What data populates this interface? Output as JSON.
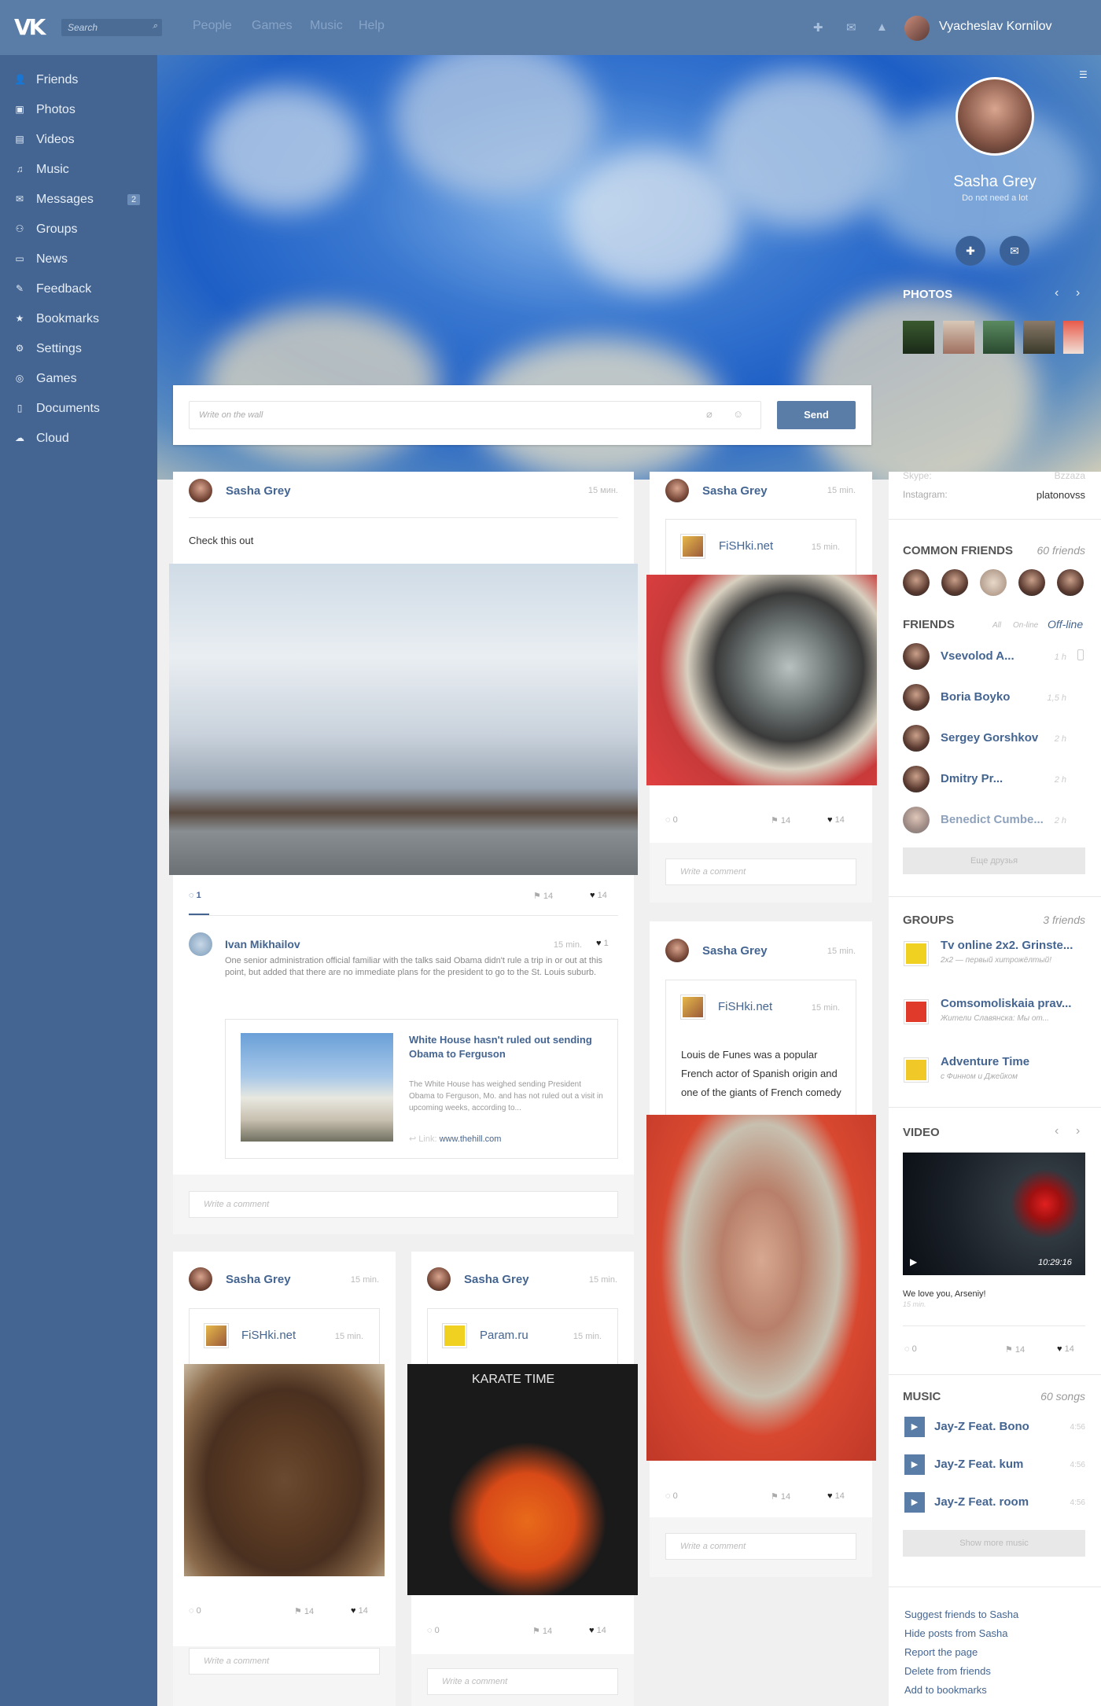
{
  "topbar": {
    "logo": "VK",
    "search_placeholder": "Search",
    "nav": [
      "People",
      "Games",
      "Music",
      "Help"
    ],
    "user_name": "Vyacheslav Kornilov"
  },
  "sidebar": {
    "items": [
      {
        "label": "Friends",
        "icon": "person-icon"
      },
      {
        "label": "Photos",
        "icon": "photo-icon"
      },
      {
        "label": "Videos",
        "icon": "film-icon"
      },
      {
        "label": "Music",
        "icon": "music-icon"
      },
      {
        "label": "Messages",
        "icon": "envelope-icon",
        "count": "2"
      },
      {
        "label": "Groups",
        "icon": "group-icon"
      },
      {
        "label": "News",
        "icon": "speech-icon"
      },
      {
        "label": "Feedback",
        "icon": "feedback-icon"
      },
      {
        "label": "Bookmarks",
        "icon": "star-icon"
      },
      {
        "label": "Settings",
        "icon": "gear-icon"
      },
      {
        "label": "Games",
        "icon": "gamepad-icon"
      },
      {
        "label": "Documents",
        "icon": "document-icon"
      },
      {
        "label": "Cloud",
        "icon": "cloud-icon"
      }
    ]
  },
  "profile": {
    "name": "Sasha Grey",
    "status": "Do not need a lot"
  },
  "photos": {
    "title": "PHOTOS"
  },
  "wall": {
    "placeholder": "Write on the wall",
    "send": "Send"
  },
  "info": {
    "row1_label": "Skype:",
    "row1_value": "Bzzaza",
    "row2_label": "Instagram:",
    "row2_value": "platonovss"
  },
  "common_friends": {
    "title": "COMMON FRIENDS",
    "count": "60 friends"
  },
  "friends": {
    "title": "FRIENDS",
    "filters": [
      "All",
      "On-line",
      "Off-line"
    ],
    "items": [
      {
        "name": "Vsevolod A...",
        "time": "1 h"
      },
      {
        "name": "Boria Boyko",
        "time": "1,5 h"
      },
      {
        "name": "Sergey Gorshkov",
        "time": "2 h"
      },
      {
        "name": "Dmitry Pr...",
        "time": "2 h"
      },
      {
        "name": "Benedict Cumbe...",
        "time": "2 h"
      }
    ],
    "more": "Еще друзья"
  },
  "groups": {
    "title": "GROUPS",
    "count": "3 friends",
    "items": [
      {
        "name": "Tv online 2x2. Grinste...",
        "sub": "2x2 — первый хитрожёлтый!"
      },
      {
        "name": "Comsomoliskaia prav...",
        "sub": "Жители Славянска: Мы от..."
      },
      {
        "name": "Adventure Time",
        "sub": "с Финном и Джейком"
      }
    ]
  },
  "video": {
    "title": "VIDEO",
    "duration": "10:29:16",
    "caption": "We love you, Arseniy!",
    "time": "15 min.",
    "comments": "0",
    "reposts": "14",
    "likes": "14"
  },
  "music": {
    "title": "MUSIC",
    "count": "60 songs",
    "items": [
      {
        "name": "Jay-Z Feat. Bono",
        "dur": "4:56"
      },
      {
        "name": "Jay-Z Feat. kum",
        "dur": "4:56"
      },
      {
        "name": "Jay-Z Feat. room",
        "dur": "4:56"
      }
    ],
    "more": "Show more music"
  },
  "actions": [
    "Suggest friends to Sasha",
    "Hide posts from Sasha",
    "Report the page",
    "Delete from friends",
    "Add to bookmarks"
  ],
  "post1": {
    "author": "Sasha Grey",
    "time": "15 мин.",
    "text": "Check this out",
    "comments": "1",
    "reposts": "14",
    "likes": "14",
    "comment": {
      "author": "Ivan Mikhailov",
      "time": "15 min.",
      "likes": "1",
      "text": "One senior administration official familiar with the talks said Obama didn't rule a trip in or out at this point, but added that there are no immediate plans for the president to go to the St. Louis suburb.",
      "link_title": "White House hasn't ruled out sending Obama to Ferguson",
      "link_text": "The White House has weighed sending President Obama to Ferguson, Mo. and has not ruled out a visit in upcoming weeks, according to...",
      "link_label": "Link:",
      "link_url": "www.thehill.com"
    },
    "write": "Write a comment"
  },
  "post2": {
    "author": "Sasha Grey",
    "time": "15 min.",
    "source": "FiSHki.net",
    "source_time": "15 min.",
    "comments": "0",
    "reposts": "14",
    "likes": "14",
    "write": "Write a comment"
  },
  "post3": {
    "author": "Sasha Grey",
    "time": "15 min.",
    "source": "FiSHki.net",
    "source_time": "15 min.",
    "text": "Louis de Funes was a popular French actor of Spanish origin and one of the giants of French comedy",
    "comments": "0",
    "reposts": "14",
    "likes": "14",
    "write": "Write a comment"
  },
  "post4": {
    "author": "Sasha Grey",
    "time": "15 min.",
    "source": "FiSHki.net",
    "source_time": "15 min.",
    "comments": "0",
    "reposts": "14",
    "likes": "14",
    "write": "Write a comment"
  },
  "post5": {
    "author": "Sasha Grey",
    "time": "15 min.",
    "source": "Param.ru",
    "source_time": "15 min.",
    "comments": "0",
    "reposts": "14",
    "likes": "14",
    "write": "Write a comment",
    "image_title": "KARATE TIME"
  }
}
